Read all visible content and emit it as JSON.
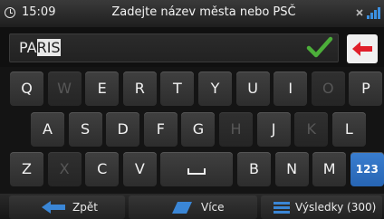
{
  "status": {
    "time": "15:09",
    "title": "Zadejte název města nebo PSČ",
    "icons": [
      "clock-icon",
      "gps-signal-icon"
    ]
  },
  "input": {
    "typed": "PA",
    "suggestion": "RIS",
    "confirm_icon": "check-icon",
    "delete_icon": "backspace-icon"
  },
  "keyboard": {
    "rows": [
      [
        {
          "label": "Q",
          "enabled": true
        },
        {
          "label": "W",
          "enabled": false
        },
        {
          "label": "E",
          "enabled": true
        },
        {
          "label": "R",
          "enabled": true
        },
        {
          "label": "T",
          "enabled": true
        },
        {
          "label": "Y",
          "enabled": true
        },
        {
          "label": "U",
          "enabled": true
        },
        {
          "label": "I",
          "enabled": true
        },
        {
          "label": "O",
          "enabled": false
        },
        {
          "label": "P",
          "enabled": true
        }
      ],
      [
        {
          "label": "A",
          "enabled": true
        },
        {
          "label": "S",
          "enabled": true
        },
        {
          "label": "D",
          "enabled": true
        },
        {
          "label": "F",
          "enabled": true
        },
        {
          "label": "G",
          "enabled": true
        },
        {
          "label": "H",
          "enabled": false
        },
        {
          "label": "J",
          "enabled": true
        },
        {
          "label": "K",
          "enabled": false
        },
        {
          "label": "L",
          "enabled": true
        }
      ],
      [
        {
          "label": "Z",
          "enabled": true
        },
        {
          "label": "X",
          "enabled": false
        },
        {
          "label": "C",
          "enabled": true
        },
        {
          "label": "V",
          "enabled": true
        },
        {
          "label": "space",
          "enabled": true
        },
        {
          "label": "B",
          "enabled": true
        },
        {
          "label": "N",
          "enabled": true
        },
        {
          "label": "M",
          "enabled": true
        },
        {
          "label": "123",
          "enabled": true
        }
      ]
    ]
  },
  "bottom_bar": {
    "back_label": "Zpět",
    "more_label": "Více",
    "results_label": "Výsledky (300)",
    "accent": "#3a86d6"
  }
}
